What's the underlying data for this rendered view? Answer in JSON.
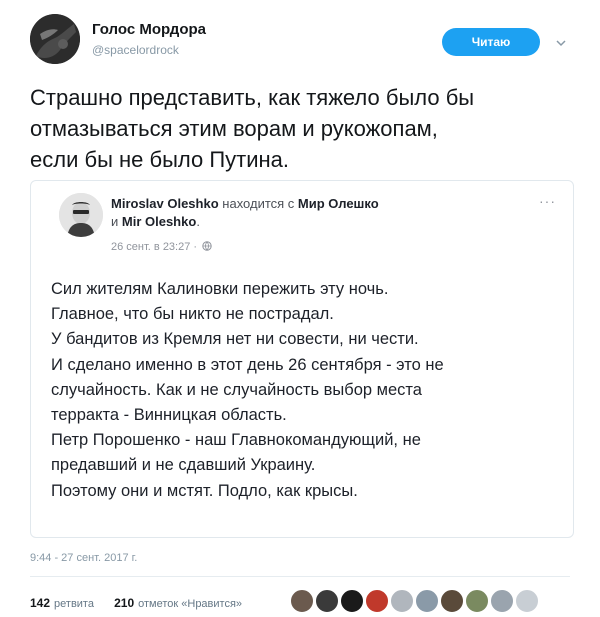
{
  "author": {
    "name": "Голос Мордора",
    "handle": "@spacelordrock",
    "follow_label": "Читаю"
  },
  "tweet": {
    "text_lines": [
      "Страшно представить, как тяжело было бы",
      "отмазываться этим ворам и рукожопам,",
      "если бы не было Путина."
    ]
  },
  "quoted_post": {
    "author_name": "Miroslav Oleshko",
    "location_prefix": "находится с",
    "location_name": "Мир Олешко",
    "location_conj": "и",
    "location_name2": "Mir Oleshko",
    "location_end": ".",
    "date": "26 сент. в 23:27 ·",
    "more_icon": "···",
    "body_lines": [
      "Сил жителям Калиновки пережить эту ночь.",
      "Главное, что бы никто не пострадал.",
      "У бандитов из Кремля нет ни совести, ни чести.",
      "И сделано именно в этот день 26 сентября - это не",
      "случайность. Как и не случайность выбор места",
      "терракта - Винницкая область.",
      "Петр Порошенко - наш Главнокомандующий, не",
      "предавший и не сдавший Украину.",
      "Поэтому они и мстят. Подло, как крысы."
    ]
  },
  "timestamp": "9:44 - 27 сент. 2017 г.",
  "stats": {
    "retweets_count": "142",
    "retweets_label": "ретвита",
    "likes_count": "210",
    "likes_label": "отметок «Нравится»"
  },
  "liker_avatar_colors": [
    "#6b5a4e",
    "#3a3a3a",
    "#1a1a1a",
    "#c0392b",
    "#b0b6bd",
    "#8a9aa8",
    "#5a4a3a",
    "#7a8a60",
    "#9aa4ae",
    "#c8ced4"
  ],
  "colors": {
    "accent": "#1da1f2",
    "text": "#14171a",
    "muted": "#8899a6"
  }
}
